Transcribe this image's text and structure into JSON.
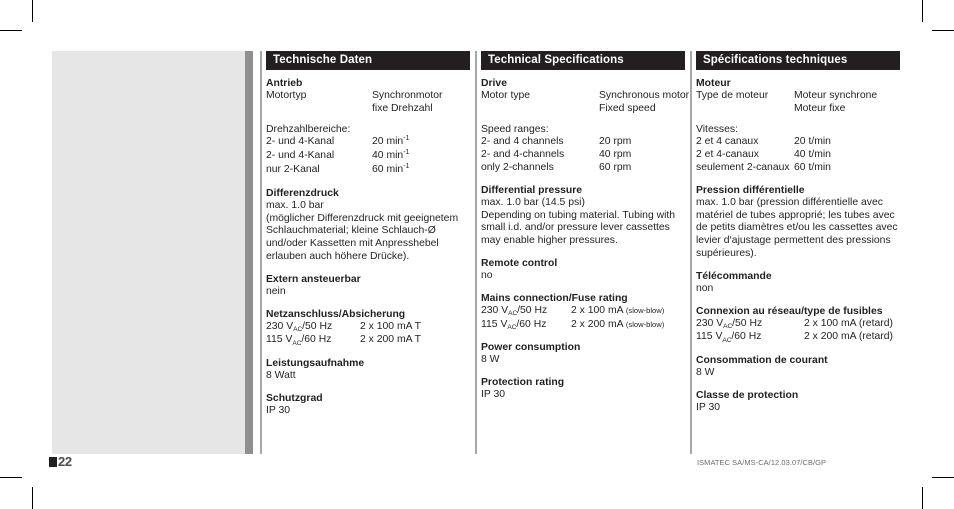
{
  "page": {
    "number": "22",
    "doc_code": "ISMATEC SA/MS-CA/12.03.07/CB/GP"
  },
  "columns": {
    "de": {
      "header": "Technische Daten",
      "drive": {
        "title": "Antrieb",
        "motor_label": "Motortyp",
        "motor_value_1": "Synchronmotor",
        "motor_value_2": "fixe Drehzahl",
        "speed_title": "Drehzahlbereiche:",
        "speeds": [
          {
            "label": "2- und 4-Kanal",
            "value": "20 min",
            "exp": "-1"
          },
          {
            "label": "2- und 4-Kanal",
            "value": "40 min",
            "exp": "-1"
          },
          {
            "label": "nur 2-Kanal",
            "value": "60 min",
            "exp": "-1"
          }
        ]
      },
      "pressure": {
        "title": "Differenzdruck",
        "line1": "max. 1.0 bar",
        "body": "(möglicher Differenzdruck mit geeignetem Schlauchmaterial; kleine Schlauch-Ø und/oder Kassetten mit Anpresshebel erlauben auch höhere Drücke)."
      },
      "remote": {
        "title": "Extern ansteuerbar",
        "value": "nein"
      },
      "mains": {
        "title": "Netzanschluss/Absicherung",
        "rows": [
          {
            "volt": "230 V",
            "sub": "AC",
            "freq": "/50 Hz",
            "fuse": "2 x 100 mA T",
            "note": ""
          },
          {
            "volt": "115 V",
            "sub": "AC",
            "freq": "/60 Hz",
            "fuse": "2 x 200 mA T",
            "note": ""
          }
        ]
      },
      "power": {
        "title": "Leistungsaufnahme",
        "value": "8 Watt"
      },
      "protection": {
        "title": "Schutzgrad",
        "value": "IP 30"
      }
    },
    "en": {
      "header": "Technical Specifications",
      "drive": {
        "title": "Drive",
        "motor_label": "Motor type",
        "motor_value_1": "Synchronous motor",
        "motor_value_2": "Fixed speed",
        "speed_title": "Speed ranges:",
        "speeds": [
          {
            "label": "2- and 4 channels",
            "value": "20 rpm",
            "exp": ""
          },
          {
            "label": "2- and 4-channels",
            "value": "40 rpm",
            "exp": ""
          },
          {
            "label": "only 2-channels",
            "value": "60 rpm",
            "exp": ""
          }
        ]
      },
      "pressure": {
        "title": "Differential pressure",
        "line1": "max. 1.0 bar (14.5 psi)",
        "body": "Depending on tubing material. Tubing with small i.d. and/or pressure lever cassettes may enable higher pressures."
      },
      "remote": {
        "title": "Remote control",
        "value": "no"
      },
      "mains": {
        "title": "Mains connection/Fuse rating",
        "rows": [
          {
            "volt": "230 V",
            "sub": "AC",
            "freq": "/50 Hz",
            "fuse": "2 x 100 mA",
            "note": "(slow-blow)"
          },
          {
            "volt": "115 V",
            "sub": "AC",
            "freq": "/60 Hz",
            "fuse": "2 x 200 mA",
            "note": "(slow-blow)"
          }
        ]
      },
      "power": {
        "title": "Power consumption",
        "value": "8 W"
      },
      "protection": {
        "title": "Protection rating",
        "value": "IP 30"
      }
    },
    "fr": {
      "header": "Spécifications techniques",
      "drive": {
        "title": "Moteur",
        "motor_label": "Type de moteur",
        "motor_value_1": "Moteur synchrone",
        "motor_value_2": "Moteur fixe",
        "speed_title": "Vitesses:",
        "speeds": [
          {
            "label": "2 et 4 canaux",
            "value": "20 t/min",
            "exp": ""
          },
          {
            "label": "2 et 4-canaux",
            "value": "40 t/min",
            "exp": ""
          },
          {
            "label": "seulement 2-canaux",
            "value": "60 t/min",
            "exp": ""
          }
        ]
      },
      "pressure": {
        "title": "Pression différentielle",
        "line1": "",
        "body": "max. 1.0 bar (pression différentielle avec matériel de tubes approprié; les tubes avec de petits diamètres et/ou les cassettes avec levier d‘ajustage permettent des pressions supérieures)."
      },
      "remote": {
        "title": "Télécommande",
        "value": "non"
      },
      "mains": {
        "title": "Connexion au réseau/type de fusibles",
        "rows": [
          {
            "volt": "230 V",
            "sub": "AC",
            "freq": "/50 Hz",
            "fuse": "2 x 100 mA (retard)",
            "note": ""
          },
          {
            "volt": "115 V",
            "sub": "AC",
            "freq": "/60 Hz",
            "fuse": "2 x 200 mA (retard)",
            "note": ""
          }
        ]
      },
      "power": {
        "title": "Consommation de courant",
        "value": "8 W"
      },
      "protection": {
        "title": "Classe de protection",
        "value": "IP 30"
      }
    }
  }
}
